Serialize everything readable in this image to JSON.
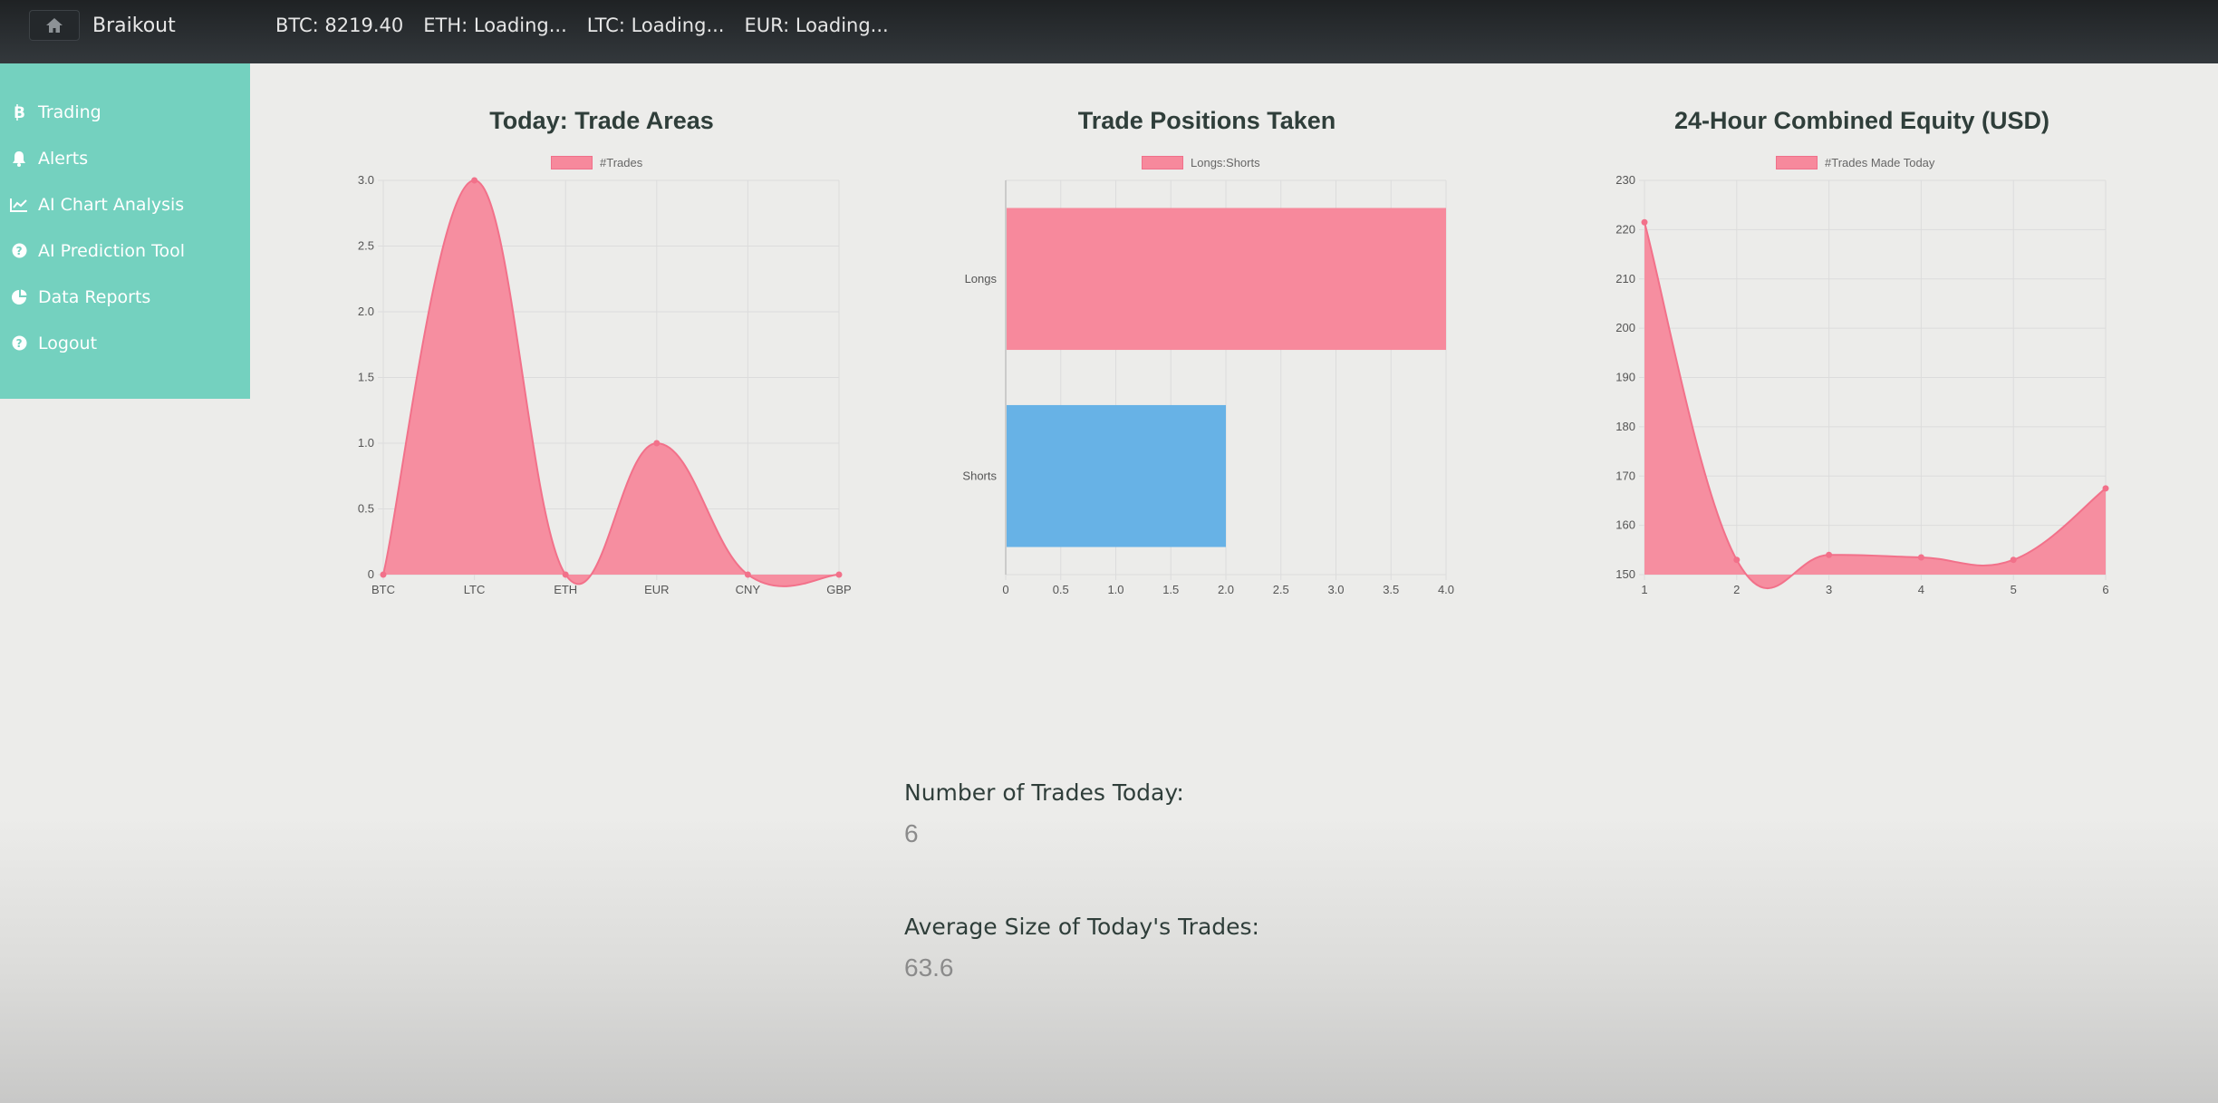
{
  "brand": {
    "name": "Braikout"
  },
  "ticker": [
    {
      "label": "BTC: 8219.40"
    },
    {
      "label": "ETH: Loading..."
    },
    {
      "label": "LTC: Loading..."
    },
    {
      "label": "EUR: Loading..."
    }
  ],
  "sidebar": {
    "items": [
      {
        "label": "Trading",
        "icon": "bitcoin-icon"
      },
      {
        "label": "Alerts",
        "icon": "bell-icon"
      },
      {
        "label": "AI Chart Analysis",
        "icon": "line-chart-icon"
      },
      {
        "label": "AI Prediction Tool",
        "icon": "question-circle-icon"
      },
      {
        "label": "Data Reports",
        "icon": "pie-chart-icon"
      },
      {
        "label": "Logout",
        "icon": "question-circle-icon"
      }
    ]
  },
  "colors": {
    "pink": "#f7899c",
    "blue": "#67b2e6",
    "teal": "#74d1bf",
    "topbar": "#2a2e31"
  },
  "chart_data": [
    {
      "type": "area",
      "title": "Today: Trade Areas",
      "categories": [
        "BTC",
        "LTC",
        "ETH",
        "EUR",
        "CNY",
        "GBP"
      ],
      "series": [
        {
          "name": "#Trades",
          "values": [
            0,
            3,
            0,
            1,
            0,
            0
          ]
        }
      ],
      "ylim": [
        0,
        3
      ],
      "yticks": [
        "0",
        "0.5",
        "1.0",
        "1.5",
        "2.0",
        "2.5",
        "3.0"
      ],
      "grid": true,
      "legend": "top"
    },
    {
      "type": "bar",
      "orientation": "horizontal",
      "title": "Trade Positions Taken",
      "categories": [
        "Longs",
        "Shorts"
      ],
      "series": [
        {
          "name": "Longs:Shorts",
          "values": [
            4,
            2
          ]
        }
      ],
      "xlim": [
        0,
        4
      ],
      "xticks": [
        "0",
        "0.5",
        "1.0",
        "1.5",
        "2.0",
        "2.5",
        "3.0",
        "3.5",
        "4.0"
      ],
      "grid": true,
      "legend": "top"
    },
    {
      "type": "area",
      "title": "24-Hour Combined Equity (USD)",
      "x": [
        1,
        2,
        3,
        4,
        5,
        6
      ],
      "series": [
        {
          "name": "#Trades Made Today",
          "values": [
            221.5,
            153,
            154,
            153.5,
            153,
            167.5
          ]
        }
      ],
      "ylim": [
        150,
        230
      ],
      "yticks": [
        "150",
        "160",
        "170",
        "180",
        "190",
        "200",
        "210",
        "220",
        "230"
      ],
      "xticks": [
        "1",
        "2",
        "3",
        "4",
        "5",
        "6"
      ],
      "grid": true,
      "legend": "top"
    }
  ],
  "stats": {
    "trades_today_label": "Number of Trades Today:",
    "trades_today_value": "6",
    "avg_size_label": "Average Size of Today's Trades:",
    "avg_size_value": "63.6"
  }
}
